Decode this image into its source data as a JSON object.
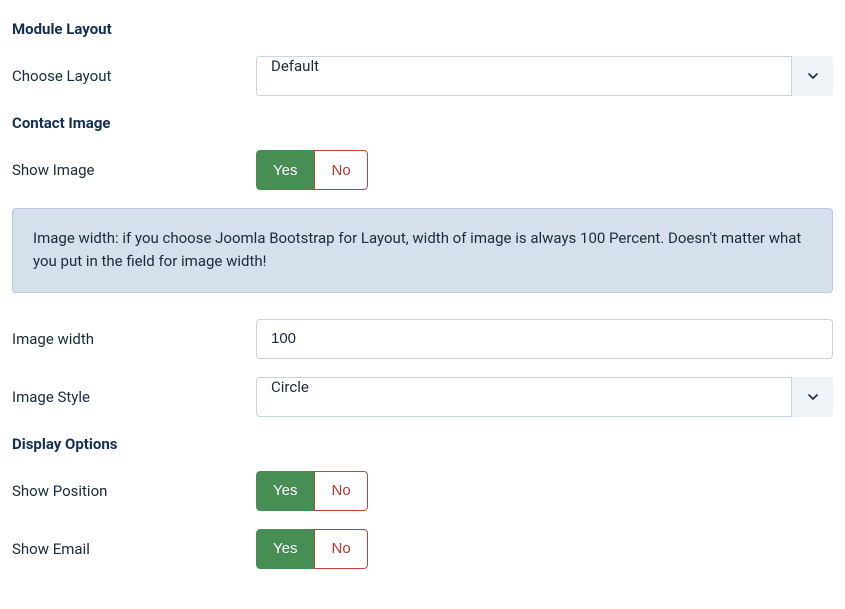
{
  "sections": {
    "module_layout": {
      "title": "Module Layout",
      "choose_layout_label": "Choose Layout",
      "choose_layout_value": "Default"
    },
    "contact_image": {
      "title": "Contact Image",
      "show_image_label": "Show Image",
      "show_image_yes": "Yes",
      "show_image_no": "No",
      "info_text": "Image width: if you choose Joomla Bootstrap for Layout, width of image is always 100 Percent. Doesn't matter what you put in the field for image width!",
      "image_width_label": "Image width",
      "image_width_value": "100",
      "image_style_label": "Image Style",
      "image_style_value": "Circle"
    },
    "display_options": {
      "title": "Display Options",
      "show_position_label": "Show Position",
      "show_position_yes": "Yes",
      "show_position_no": "No",
      "show_email_label": "Show Email",
      "show_email_yes": "Yes",
      "show_email_no": "No"
    }
  }
}
